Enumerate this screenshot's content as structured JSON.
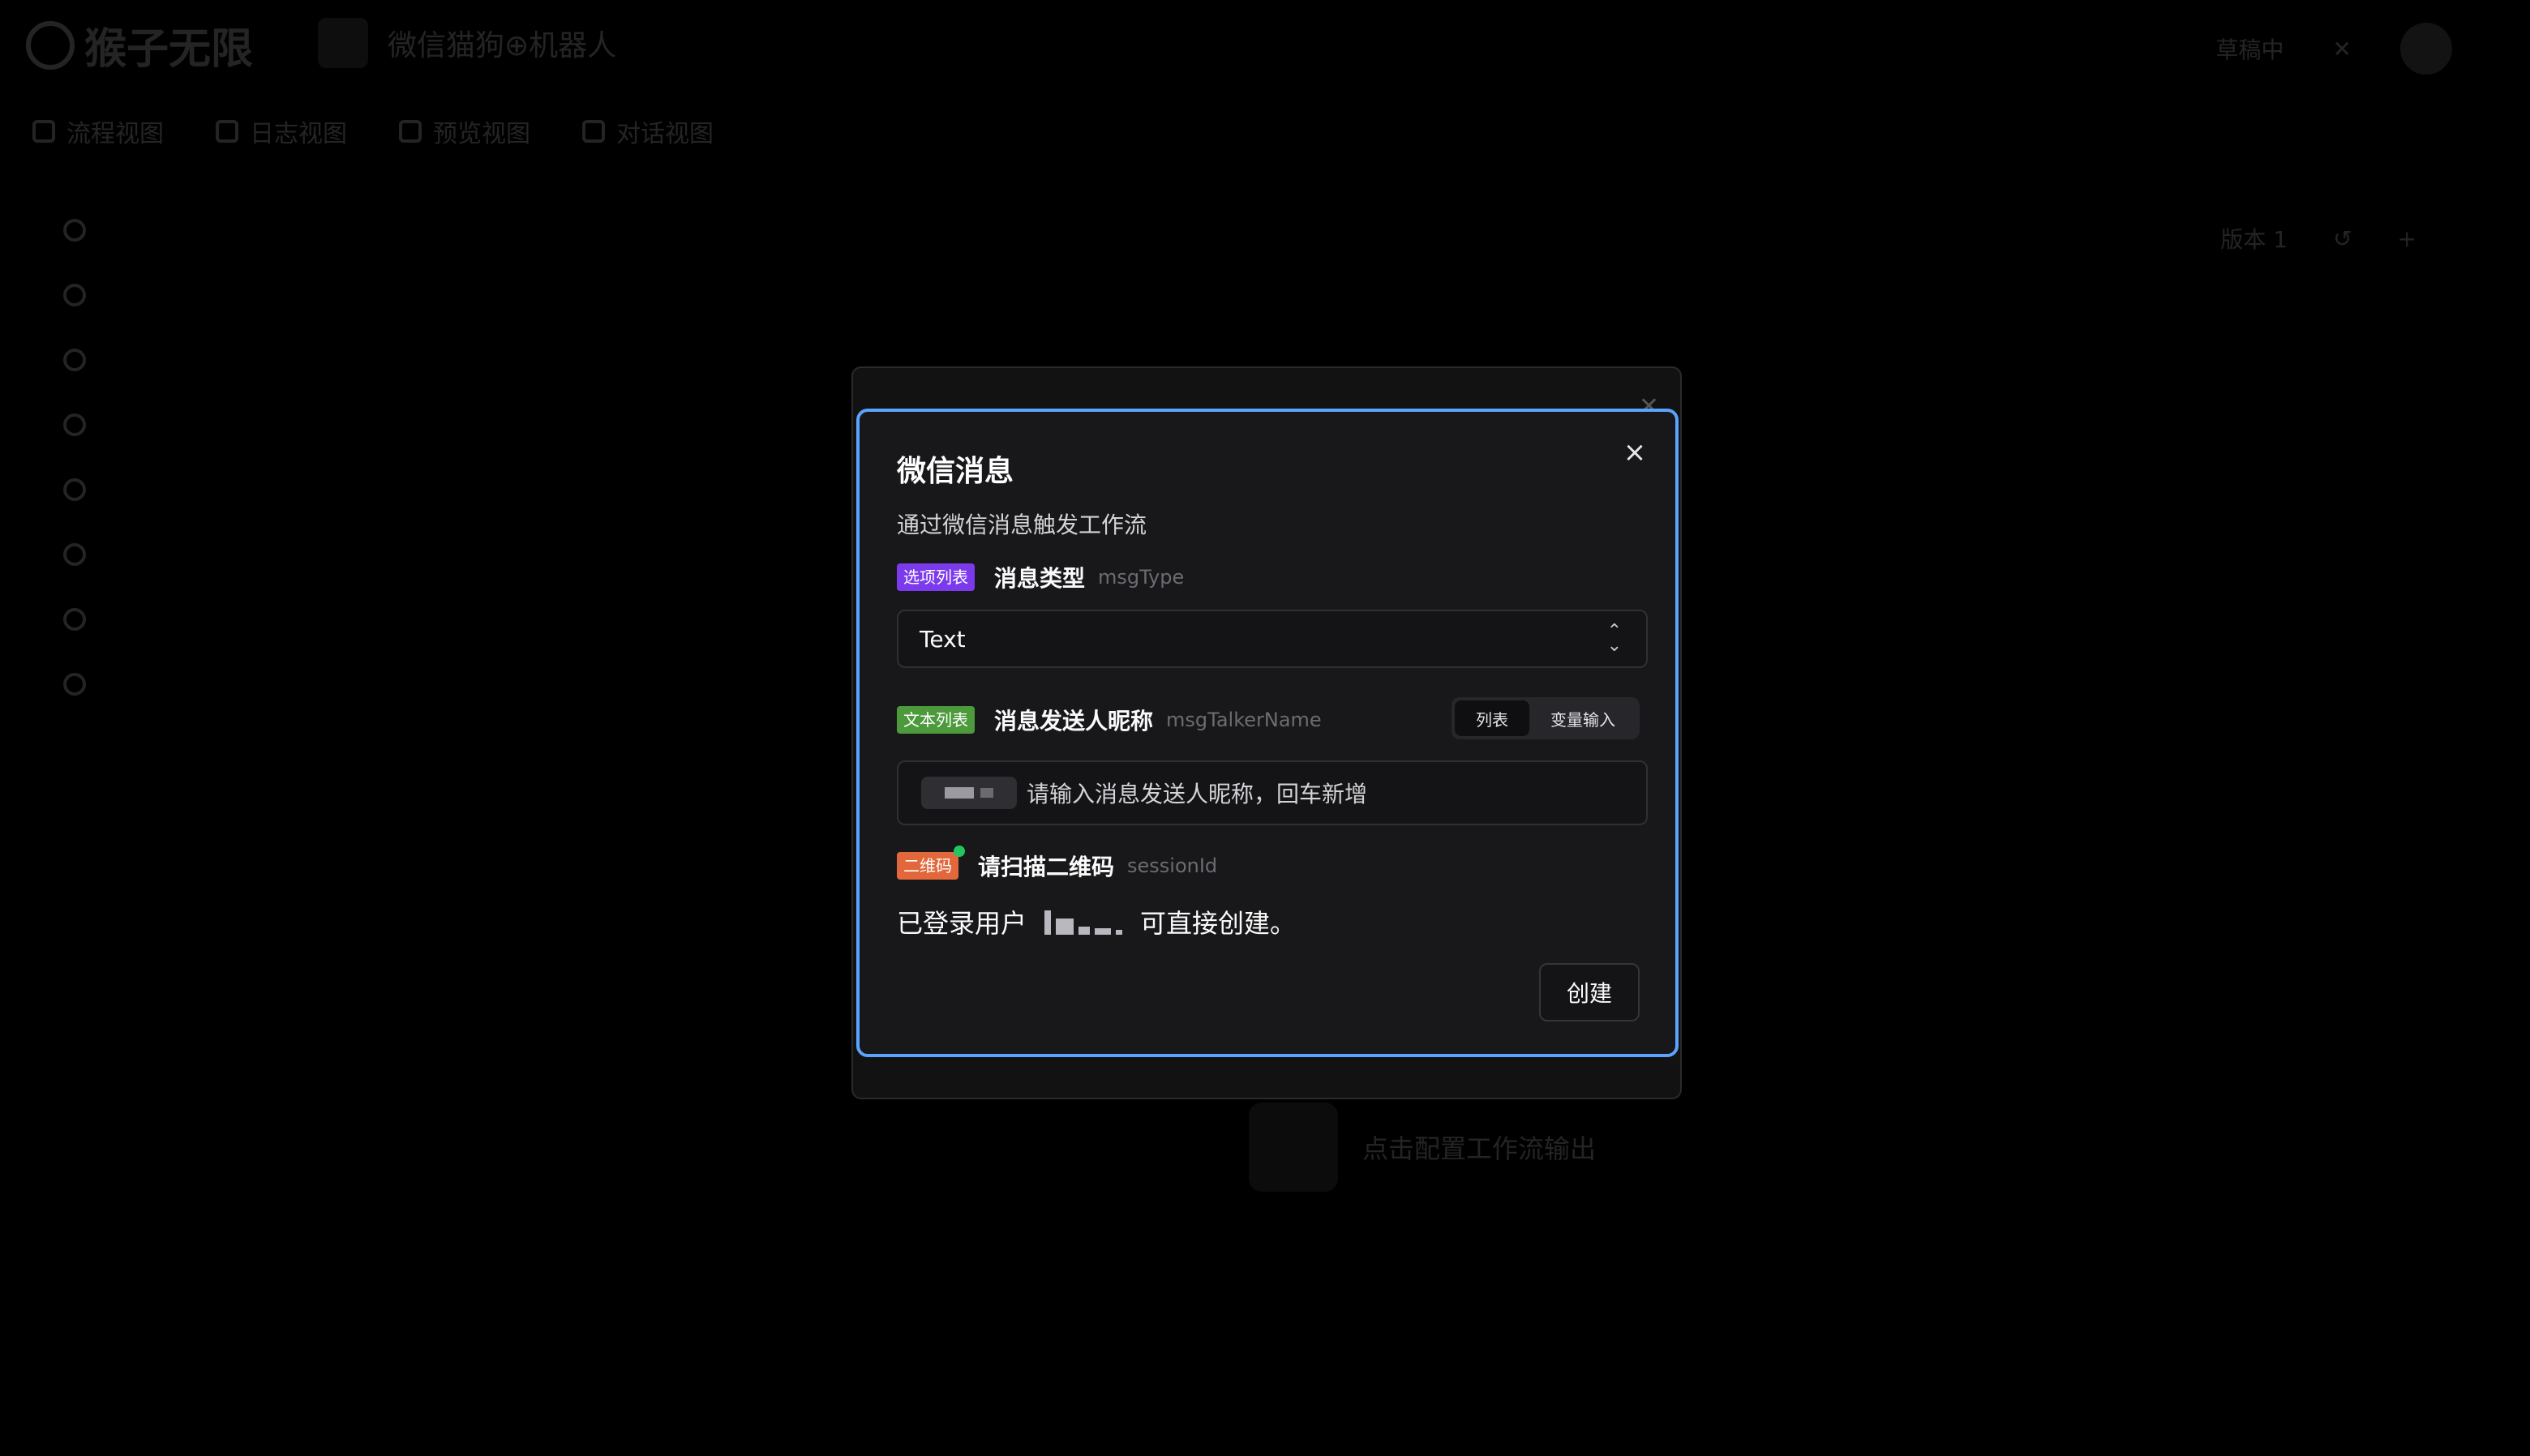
{
  "background": {
    "brand": "猴子无限",
    "project_title": "微信猫狗⊕机器人",
    "status": "草稿中",
    "tabs": [
      {
        "label": "流程视图"
      },
      {
        "label": "日志视图"
      },
      {
        "label": "预览视图"
      },
      {
        "label": "对话视图"
      }
    ],
    "version_label": "版本 1",
    "empty_hint": "点击配置工作流输出"
  },
  "modal": {
    "title": "微信消息",
    "description": "通过微信消息触发工作流",
    "close_icon": "×",
    "fields": {
      "msg_type": {
        "badge": "选项列表",
        "label": "消息类型",
        "key": "msgType",
        "selected_value": "Text"
      },
      "talker_name": {
        "badge": "文本列表",
        "label": "消息发送人昵称",
        "key": "msgTalkerName",
        "toggle_options": [
          "列表",
          "变量输入"
        ],
        "toggle_selected": "列表",
        "placeholder": "请输入消息发送人昵称，回车新增"
      },
      "session": {
        "badge": "二维码",
        "label": "请扫描二维码",
        "key": "sessionId",
        "login_prefix": "已登录用户",
        "login_suffix": "可直接创建。"
      }
    },
    "create_button": "创建"
  },
  "colors": {
    "modal_border": "#5aa3ff",
    "badge_options": "#7c3aed",
    "badge_text_list": "#4d9a3c",
    "badge_qr": "#e2683c",
    "status_dot": "#22c55e"
  }
}
